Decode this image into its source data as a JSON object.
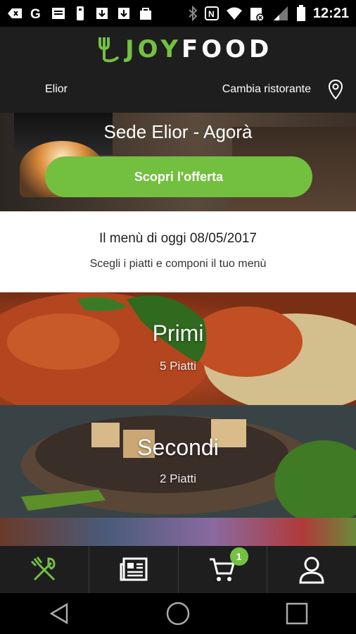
{
  "status_bar": {
    "time": "12:21",
    "left_icons": [
      "notification-back-icon",
      "google-icon",
      "image-icon",
      "usb-icon",
      "download-icon",
      "download-icon",
      "bag-icon"
    ],
    "right_icons": [
      "bluetooth-icon",
      "nfc-icon",
      "wifi-icon",
      "data-off-icon",
      "signal-icon",
      "battery-icon"
    ]
  },
  "header": {
    "logo_joy": "JOY",
    "logo_food": "FOOD",
    "restaurant_name": "Elior",
    "change_restaurant_label": "Cambia ristorante"
  },
  "hero": {
    "title": "Sede Elior - Agorà",
    "offer_button": "Scopri l'offerta"
  },
  "menu": {
    "title": "Il menù di oggi 08/05/2017",
    "subtitle": "Scegli i piatti e componi il tuo menù"
  },
  "categories": [
    {
      "name": "Primi",
      "count": "5 Piatti"
    },
    {
      "name": "Secondi",
      "count": "2 Piatti"
    }
  ],
  "bottom_nav": {
    "items": [
      "menu-icon",
      "news-icon",
      "cart-icon",
      "profile-icon"
    ],
    "cart_badge": "1"
  },
  "colors": {
    "brand_green": "#74c043",
    "header_bg": "#1e1e1e"
  }
}
